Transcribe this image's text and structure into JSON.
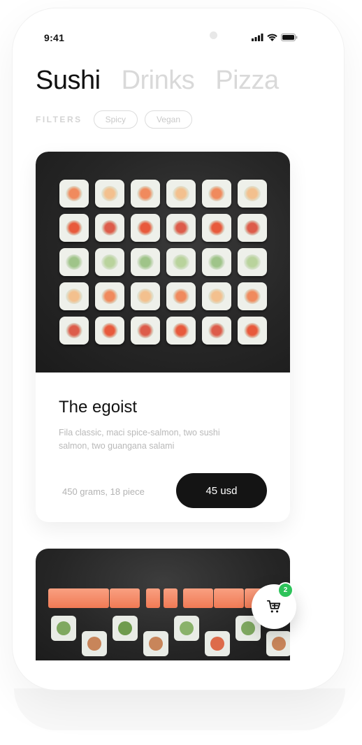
{
  "status": {
    "time": "9:41"
  },
  "tabs": [
    {
      "label": "Sushi",
      "active": true
    },
    {
      "label": "Drinks",
      "active": false
    },
    {
      "label": "Pizza",
      "active": false
    }
  ],
  "filters": {
    "label": "FILTERS",
    "chips": [
      "Spicy",
      "Vegan"
    ]
  },
  "product": {
    "title": "The egoist",
    "description": "Fila classic, maci spice-salmon, two sushi salmon, two guangana salami",
    "weight": "450 grams, 18 piece",
    "price": "45 usd"
  },
  "cart": {
    "count": "2",
    "icon": "cart-icon",
    "badge_color": "#2ec35a"
  },
  "colors": {
    "accent": "#141414",
    "inactive_tab": "#d9d9d9"
  }
}
